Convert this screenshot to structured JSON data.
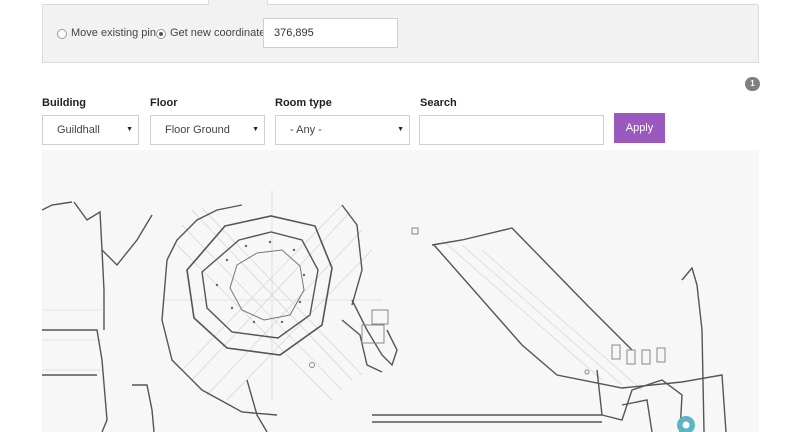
{
  "coordinates": {
    "option_move": "Move existing pin",
    "option_new": "Get new coordinates",
    "selected": "new",
    "value": "376,895"
  },
  "result_count": "1",
  "filters": {
    "building_label": "Building",
    "building_value": "Guildhall",
    "floor_label": "Floor",
    "floor_value": "Floor Ground",
    "room_type_label": "Room type",
    "room_type_value": "- Any -",
    "search_label": "Search",
    "search_value": "",
    "apply_label": "Apply"
  },
  "icons": {
    "dropdown": "caret-down-icon",
    "pin": "map-pin-icon"
  },
  "colors": {
    "accent": "#9b59c0",
    "pin": "#5bb5c4",
    "panel_bg": "#f2f2f2"
  }
}
